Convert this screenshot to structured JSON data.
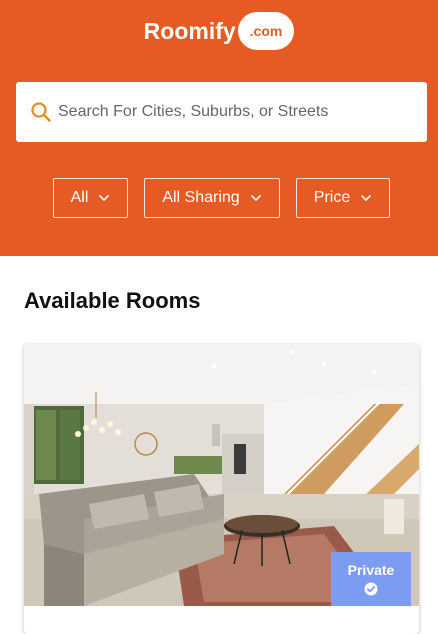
{
  "brand": {
    "name": "Roomify",
    "badge": ".com"
  },
  "search": {
    "placeholder": "Search For Cities, Suburbs, or Streets",
    "icon": "search-icon"
  },
  "filters": [
    {
      "label": "All",
      "icon": "chevron-down-icon"
    },
    {
      "label": "All Sharing",
      "icon": "chevron-down-icon"
    },
    {
      "label": "Price",
      "icon": "chevron-down-icon"
    }
  ],
  "section": {
    "title": "Available Rooms"
  },
  "rooms": [
    {
      "badge": "Private",
      "badge_icon": "check-circle-icon"
    }
  ],
  "colors": {
    "brand_orange": "#e65a24",
    "badge_blue": "#7c9cf2",
    "white": "#ffffff"
  }
}
